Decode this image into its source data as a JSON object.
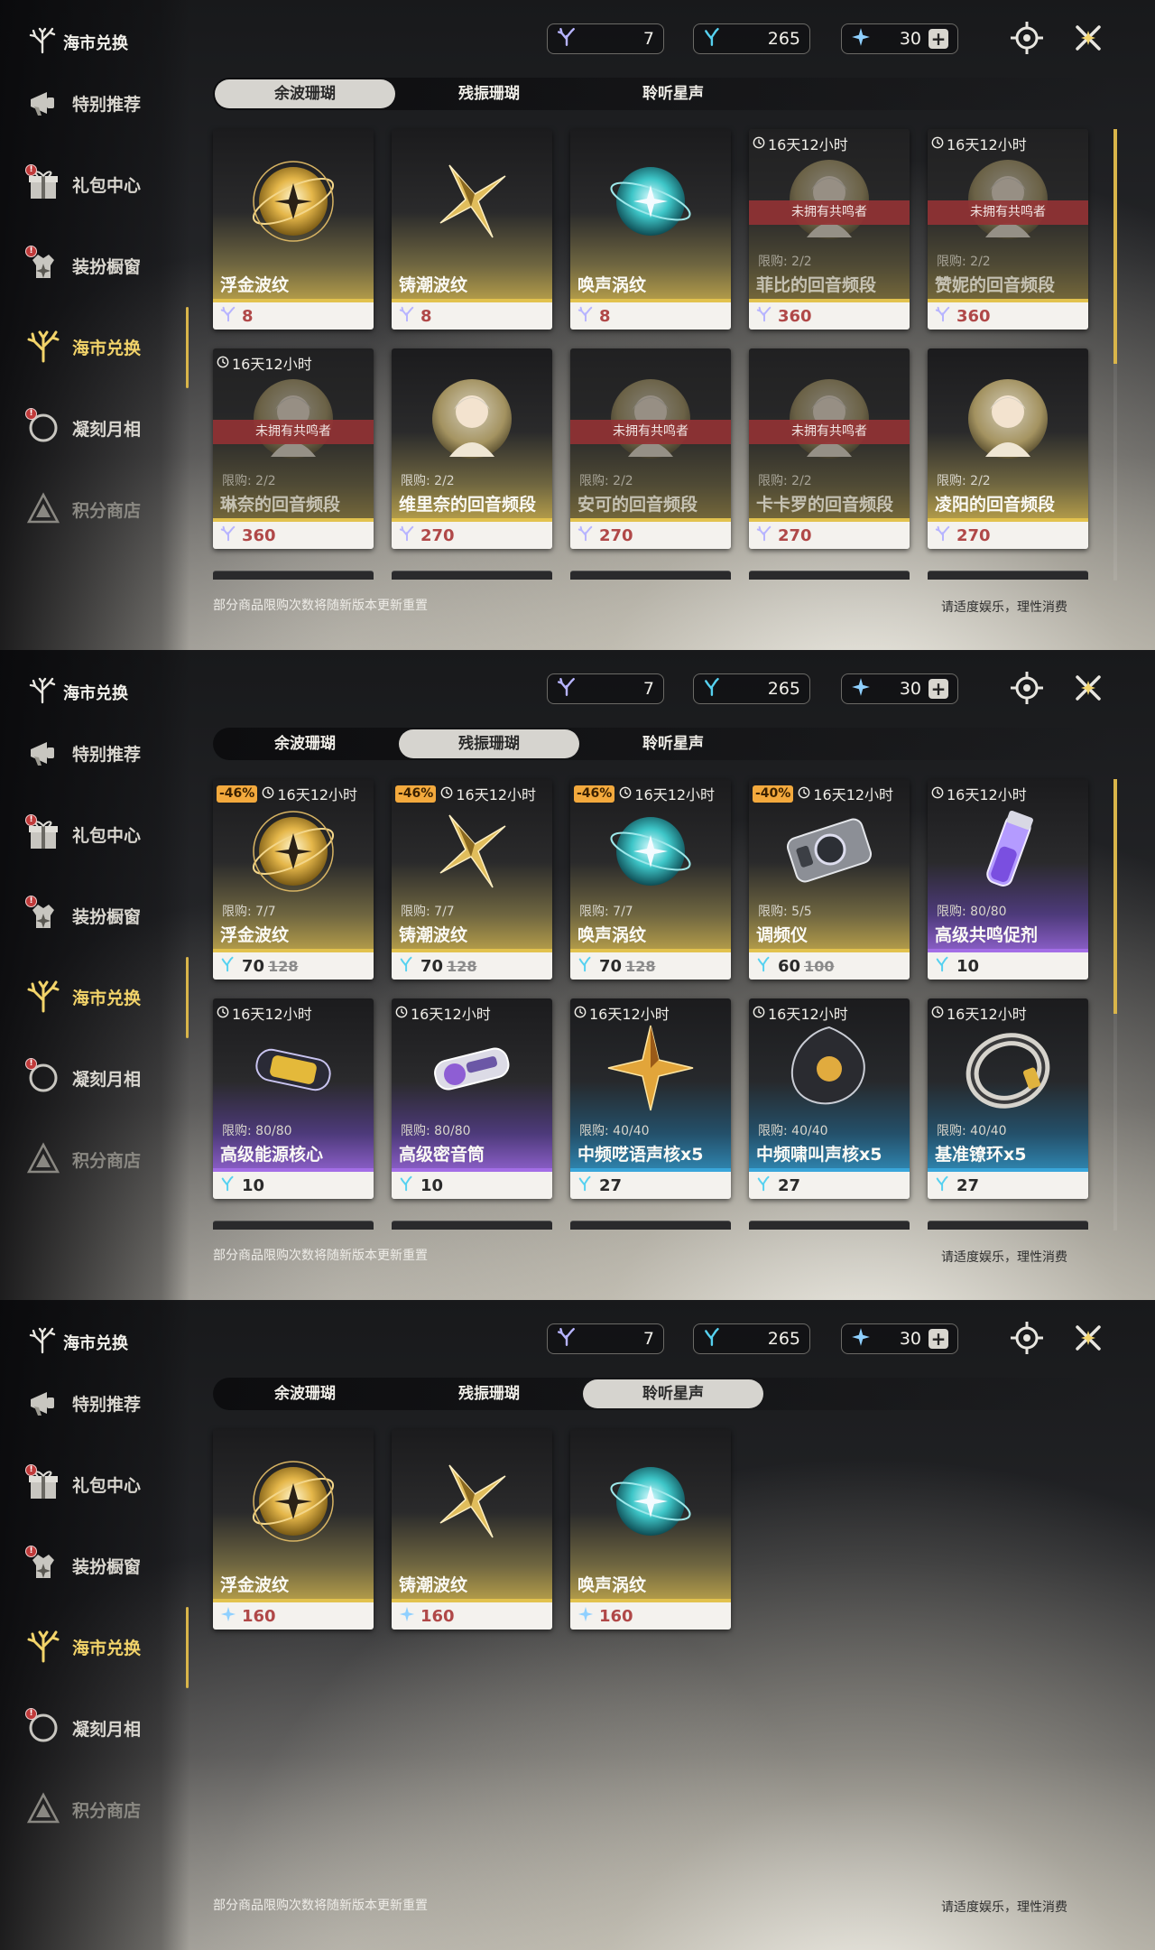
{
  "app_title": "海市兑换",
  "currencies": [
    {
      "name": "残振珊瑚",
      "icon": "coral-purple-icon",
      "value": "7"
    },
    {
      "name": "余波珊瑚",
      "icon": "coral-cyan-icon",
      "value": "265"
    },
    {
      "name": "星声",
      "icon": "star-sound-icon",
      "value": "30"
    }
  ],
  "top_icons": [
    "target-settings-icon",
    "close-x-icon"
  ],
  "nav": [
    {
      "label": "特别推荐",
      "icon": "megaphone-icon"
    },
    {
      "label": "礼包中心",
      "icon": "gift-icon",
      "badge": "!"
    },
    {
      "label": "装扮橱窗",
      "icon": "outfit-icon",
      "badge": "!"
    },
    {
      "label": "海市兑换",
      "icon": "coral-branch-icon",
      "active": true
    },
    {
      "label": "凝刻月相",
      "icon": "moon-icon",
      "badge": "!"
    },
    {
      "label": "积分商店",
      "icon": "triangle-emblem-icon"
    }
  ],
  "tabs": [
    "余波珊瑚",
    "残振珊瑚",
    "聆听星声"
  ],
  "footer_left": "部分商品限购次数将随新版本更新重置",
  "footer_right": "请适度娱乐，理性消费",
  "screens": [
    {
      "active_tab": 0,
      "cards": [
        {
          "name": "浮金波纹",
          "price": "8",
          "currency": "coral-purple",
          "art": "gold-orb",
          "theme": "gold"
        },
        {
          "name": "铸潮波纹",
          "price": "8",
          "currency": "coral-purple",
          "art": "gold-blade",
          "theme": "gold"
        },
        {
          "name": "唤声涡纹",
          "price": "8",
          "currency": "coral-purple",
          "art": "teal-orb",
          "theme": "gold"
        },
        {
          "name": "菲比的回音频段",
          "price": "360",
          "currency": "coral-purple",
          "art": "portrait",
          "theme": "gold",
          "timer": "16天12小时",
          "ribbon": "未拥有共鸣者",
          "limit": "限购: 2/2",
          "locked": true
        },
        {
          "name": "赞妮的回音频段",
          "price": "360",
          "currency": "coral-purple",
          "art": "portrait",
          "theme": "gold",
          "timer": "16天12小时",
          "ribbon": "未拥有共鸣者",
          "limit": "限购: 2/2",
          "locked": true
        },
        {
          "name": "琳奈的回音频段",
          "price": "360",
          "currency": "coral-purple",
          "art": "portrait",
          "theme": "gold",
          "timer": "16天12小时",
          "ribbon": "未拥有共鸣者",
          "limit": "限购: 2/2",
          "locked": true
        },
        {
          "name": "维里奈的回音频段",
          "price": "270",
          "currency": "coral-purple",
          "art": "portrait",
          "theme": "gold",
          "limit": "限购: 2/2"
        },
        {
          "name": "安可的回音频段",
          "price": "270",
          "currency": "coral-purple",
          "art": "portrait",
          "theme": "gold",
          "ribbon": "未拥有共鸣者",
          "limit": "限购: 2/2",
          "locked": true
        },
        {
          "name": "卡卡罗的回音频段",
          "price": "270",
          "currency": "coral-purple",
          "art": "portrait",
          "theme": "gold",
          "ribbon": "未拥有共鸣者",
          "limit": "限购: 2/2",
          "locked": true
        },
        {
          "name": "凌阳的回音频段",
          "price": "270",
          "currency": "coral-purple",
          "art": "portrait",
          "theme": "gold",
          "limit": "限购: 2/2"
        }
      ]
    },
    {
      "active_tab": 1,
      "cards": [
        {
          "name": "浮金波纹",
          "price": "70",
          "old_price": "128",
          "currency": "coral-cyan",
          "art": "gold-orb",
          "theme": "gold",
          "discount": "-46%",
          "timer": "16天12小时",
          "limit": "限购: 7/7"
        },
        {
          "name": "铸潮波纹",
          "price": "70",
          "old_price": "128",
          "currency": "coral-cyan",
          "art": "gold-blade",
          "theme": "gold",
          "discount": "-46%",
          "timer": "16天12小时",
          "limit": "限购: 7/7"
        },
        {
          "name": "唤声涡纹",
          "price": "70",
          "old_price": "128",
          "currency": "coral-cyan",
          "art": "teal-orb",
          "theme": "gold",
          "discount": "-46%",
          "timer": "16天12小时",
          "limit": "限购: 7/7"
        },
        {
          "name": "调频仪",
          "price": "60",
          "old_price": "100",
          "currency": "coral-cyan",
          "art": "device",
          "theme": "gold",
          "discount": "-40%",
          "timer": "16天12小时",
          "limit": "限购: 5/5"
        },
        {
          "name": "高级共鸣促剂",
          "price": "10",
          "currency": "coral-cyan",
          "art": "vial",
          "theme": "purple",
          "timer": "16天12小时",
          "limit": "限购: 80/80"
        },
        {
          "name": "高级能源核心",
          "price": "10",
          "currency": "coral-cyan",
          "art": "capsule",
          "theme": "purple",
          "timer": "16天12小时",
          "limit": "限购: 80/80"
        },
        {
          "name": "高级密音筒",
          "price": "10",
          "currency": "coral-cyan",
          "art": "cylinder",
          "theme": "purple",
          "timer": "16天12小时",
          "limit": "限购: 80/80"
        },
        {
          "name": "中频呓语声核x5",
          "price": "27",
          "currency": "coral-cyan",
          "art": "star-shard",
          "theme": "blue",
          "timer": "16天12小时",
          "limit": "限购: 40/40"
        },
        {
          "name": "中频啸叫声核x5",
          "price": "27",
          "currency": "coral-cyan",
          "art": "dark-core",
          "theme": "blue",
          "timer": "16天12小时",
          "limit": "限购: 40/40"
        },
        {
          "name": "基准镣环x5",
          "price": "27",
          "currency": "coral-cyan",
          "art": "ring",
          "theme": "blue",
          "timer": "16天12小时",
          "limit": "限购: 40/40"
        }
      ]
    },
    {
      "active_tab": 2,
      "cards": [
        {
          "name": "浮金波纹",
          "price": "160",
          "currency": "star-sound",
          "art": "gold-orb",
          "theme": "gold"
        },
        {
          "name": "铸潮波纹",
          "price": "160",
          "currency": "star-sound",
          "art": "gold-blade",
          "theme": "gold"
        },
        {
          "name": "唤声涡纹",
          "price": "160",
          "currency": "star-sound",
          "art": "teal-orb",
          "theme": "gold"
        }
      ]
    }
  ],
  "colors": {
    "accent_gold": "#f3d46a",
    "price_red": "#b04848",
    "ribbon_red": "#943234",
    "discount_orange": "#f3a93d"
  }
}
